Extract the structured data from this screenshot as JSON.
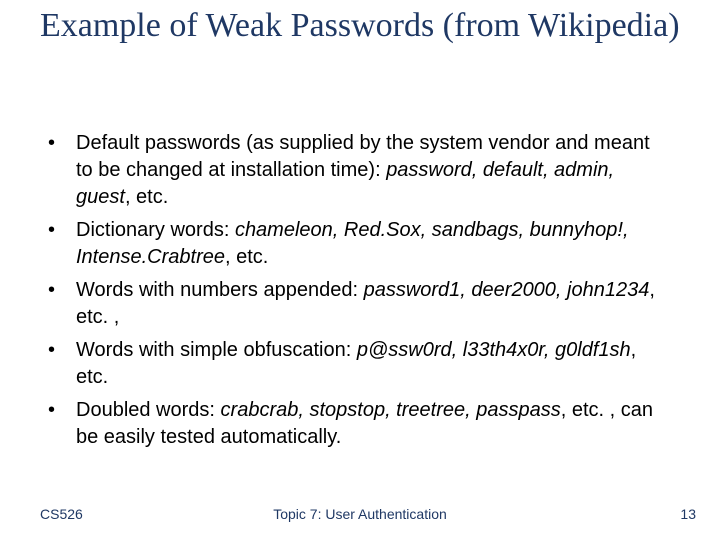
{
  "title": "Example of Weak Passwords (from Wikipedia)",
  "bullets": [
    {
      "lead": "Default passwords (as supplied by the system vendor and meant to be changed at installation time): ",
      "examples": "password, default, admin, guest",
      "tail": ", etc."
    },
    {
      "lead": "Dictionary words: ",
      "examples": "chameleon, Red.Sox, sandbags, bunnyhop!, Intense.Crabtree",
      "tail": ", etc."
    },
    {
      "lead": "Words with numbers appended: ",
      "examples": "password1, deer2000, john1234",
      "tail": ", etc. ,"
    },
    {
      "lead": "Words with simple obfuscation: ",
      "examples": "p@ssw0rd, l33th4x0r, g0ldf1sh",
      "tail": ", etc."
    },
    {
      "lead": "Doubled words: ",
      "examples": "crabcrab, stopstop, treetree, passpass",
      "tail": ", etc. , can be easily tested automatically."
    }
  ],
  "footer": {
    "left": "CS526",
    "center": "Topic 7: User Authentication",
    "right": "13"
  }
}
